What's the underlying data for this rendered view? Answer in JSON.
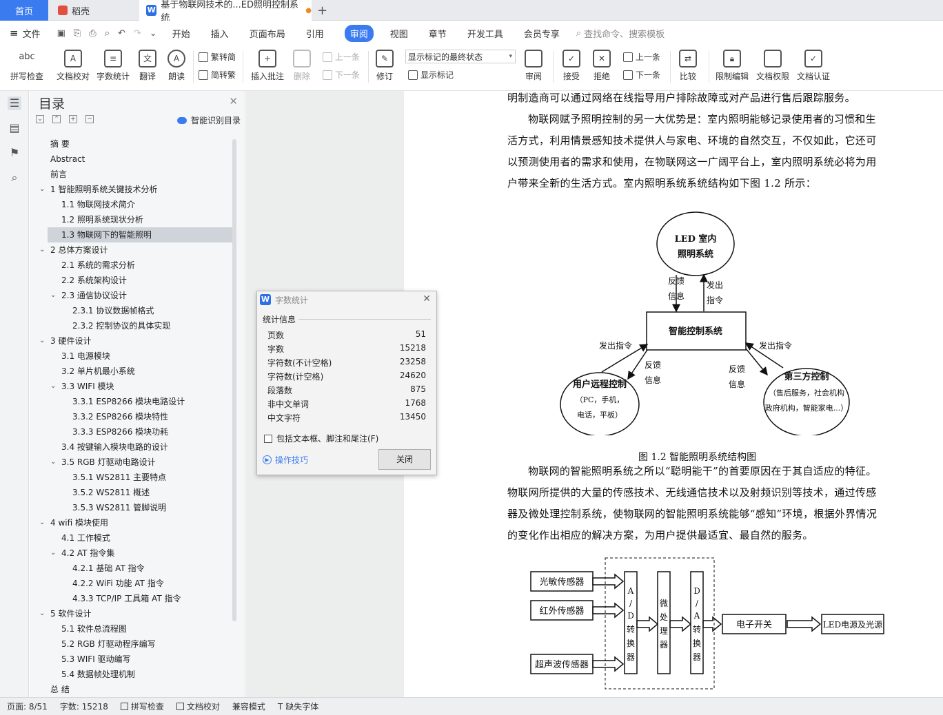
{
  "tabs": {
    "home": "首页",
    "daoke": "稻壳",
    "doc_title": "基于物联网技术的...ED照明控制系统"
  },
  "menu": {
    "file": "文件",
    "items": [
      "开始",
      "插入",
      "页面布局",
      "引用",
      "审阅",
      "视图",
      "章节",
      "开发工具",
      "会员专享"
    ],
    "active": "审阅",
    "search": "查找命令、搜索模板"
  },
  "ribbon": {
    "spell": "拼写检查",
    "proof": "文档校对",
    "wordcount": "字数统计",
    "translate": "翻译",
    "read": "朗读",
    "trad": "繁转简",
    "simp": "简转繁",
    "insert_comment": "插入批注",
    "delete": "删除",
    "prev": "上一条",
    "next": "下一条",
    "revise": "修订",
    "markup_state": "显示标记的最终状态",
    "show_markup": "显示标记",
    "review": "审阅",
    "accept": "接受",
    "reject": "拒绝",
    "prev2": "上一条",
    "next2": "下一条",
    "compare": "比较",
    "restrict": "限制编辑",
    "perm": "文档权限",
    "cert": "文档认证"
  },
  "toc": {
    "title": "目录",
    "smart": "智能识别目录",
    "items": [
      {
        "t": "摘  要",
        "lvl": 0
      },
      {
        "t": "Abstract",
        "lvl": 0
      },
      {
        "t": "前言",
        "lvl": 0
      },
      {
        "t": "1  智能照明系统关键技术分析",
        "lvl": 0,
        "arrow": true
      },
      {
        "t": "1.1  物联网技术简介",
        "lvl": 1
      },
      {
        "t": "1.2  照明系统现状分析",
        "lvl": 1
      },
      {
        "t": "1.3  物联网下的智能照明",
        "lvl": 1,
        "sel": true
      },
      {
        "t": "2  总体方案设计",
        "lvl": 0,
        "arrow": true
      },
      {
        "t": "2.1  系统的需求分析",
        "lvl": 1
      },
      {
        "t": "2.2  系统架构设计",
        "lvl": 1
      },
      {
        "t": "2.3  通信协议设计",
        "lvl": 1,
        "arrow": true
      },
      {
        "t": "2.3.1 协议数据帧格式",
        "lvl": 2
      },
      {
        "t": "2.3.2 控制协议的具体实现",
        "lvl": 2
      },
      {
        "t": "3  硬件设计",
        "lvl": 0,
        "arrow": true
      },
      {
        "t": "3.1  电源模块",
        "lvl": 1
      },
      {
        "t": "3.2  单片机最小系统",
        "lvl": 1
      },
      {
        "t": "3.3 WIFI 模块",
        "lvl": 1,
        "arrow": true
      },
      {
        "t": "3.3.1 ESP8266 模块电路设计",
        "lvl": 2
      },
      {
        "t": "3.3.2 ESP8266 模块特性",
        "lvl": 2
      },
      {
        "t": "3.3.3 ESP8266 模块功耗",
        "lvl": 2
      },
      {
        "t": "3.4  按键输入模块电路的设计",
        "lvl": 1
      },
      {
        "t": "3.5 RGB  灯驱动电路设计",
        "lvl": 1,
        "arrow": true
      },
      {
        "t": "3.5.1 WS2811 主要特点",
        "lvl": 2
      },
      {
        "t": "3.5.2 WS2811 概述",
        "lvl": 2
      },
      {
        "t": "3.5.3 WS2811 管脚说明",
        "lvl": 2
      },
      {
        "t": "4 wifi 模块使用",
        "lvl": 0,
        "arrow": true
      },
      {
        "t": "4.1  工作模式",
        "lvl": 1
      },
      {
        "t": "4.2    AT 指令集",
        "lvl": 1,
        "arrow": true
      },
      {
        "t": "4.2.1  基础 AT 指令",
        "lvl": 2
      },
      {
        "t": "4.2.2 WiFi 功能 AT 指令",
        "lvl": 2
      },
      {
        "t": "4.3.3 TCP/IP 工具箱  AT 指令",
        "lvl": 2
      },
      {
        "t": "5  软件设计",
        "lvl": 0,
        "arrow": true
      },
      {
        "t": "5.1  软件总流程图",
        "lvl": 1
      },
      {
        "t": "5.2 RGB 灯驱动程序编写",
        "lvl": 1
      },
      {
        "t": "5.3 WIFI 驱动编写",
        "lvl": 1
      },
      {
        "t": "5.4  数据帧处理机制",
        "lvl": 1
      },
      {
        "t": "总  结",
        "lvl": 0
      }
    ]
  },
  "doc": {
    "p1": "明制造商可以通过网络在线指导用户排除故障或对产品进行售后跟踪服务。",
    "p2": "物联网赋予照明控制的另一大优势是：室内照明能够记录使用者的习惯和生活方式，利用情景感知技术提供人与家电、环境的自然交互，不仅如此，它还可以预测使用者的需求和使用，在物联网这一广阔平台上，室内照明系统必将为用户带来全新的生活方式。室内照明系统系统结构如下图 1.2 所示：",
    "fig_caption": "图 1.2  智能照明系统结构图",
    "p3": "物联网的智能照明系统之所以“聪明能干”的首要原因在于其自适应的特征。物联网所提供的大量的传感技术、无线通信技术以及射频识别等技术，通过传感器及微处理控制系统，使物联网的智能照明系统能够“感知”环境，根据外界情况的变化作出相应的解决方案，为用户提供最适宜、最自然的服务。",
    "fig1": {
      "led1": "LED  室内",
      "led2": "照明系统",
      "fb1": "反馈",
      "fb2": "信息",
      "cmd1": "发出",
      "cmd2": "指令",
      "center": "智能控制系统",
      "send_left": "发出指令",
      "send_right": "发出指令",
      "fbl1": "反馈",
      "fbl2": "信息",
      "fbr1": "反馈",
      "fbr2": "信息",
      "user1": "用户远程控制",
      "user2": "（PC，手机，",
      "user3": "电话，平板）",
      "third1": "第三方控制",
      "third2": "（售后服务，社会机构",
      "third3": "政府机构，智能家电...）"
    },
    "fig2": {
      "s1": "光敏传感器",
      "s2": "红外传感器",
      "s3": "超声波传感器",
      "ad": [
        "A",
        "/",
        "D",
        "转",
        "换",
        "器"
      ],
      "mcu": [
        "微",
        "处",
        "理",
        "器"
      ],
      "da": [
        "D",
        "/",
        "A",
        "转",
        "换",
        "器"
      ],
      "switch": "电子开关",
      "led": "LED电源及光源"
    }
  },
  "dialog": {
    "title": "字数统计",
    "section": "统计信息",
    "rows": [
      {
        "k": "页数",
        "v": "51"
      },
      {
        "k": "字数",
        "v": "15218"
      },
      {
        "k": "字符数(不计空格)",
        "v": "23258"
      },
      {
        "k": "字符数(计空格)",
        "v": "24620"
      },
      {
        "k": "段落数",
        "v": "875"
      },
      {
        "k": "非中文单词",
        "v": "1768"
      },
      {
        "k": "中文字符",
        "v": "13450"
      }
    ],
    "include": "包括文本框、脚注和尾注(F)",
    "tips": "操作技巧",
    "close": "关闭"
  },
  "status": {
    "page": "页面: 8/51",
    "words": "字数: 15218",
    "spell": "拼写检查",
    "proof": "文档校对",
    "compat": "兼容模式",
    "font": "缺失字体"
  },
  "colors": {
    "accent": "#3b7bf0",
    "selected_toc": "#cfd4db"
  }
}
